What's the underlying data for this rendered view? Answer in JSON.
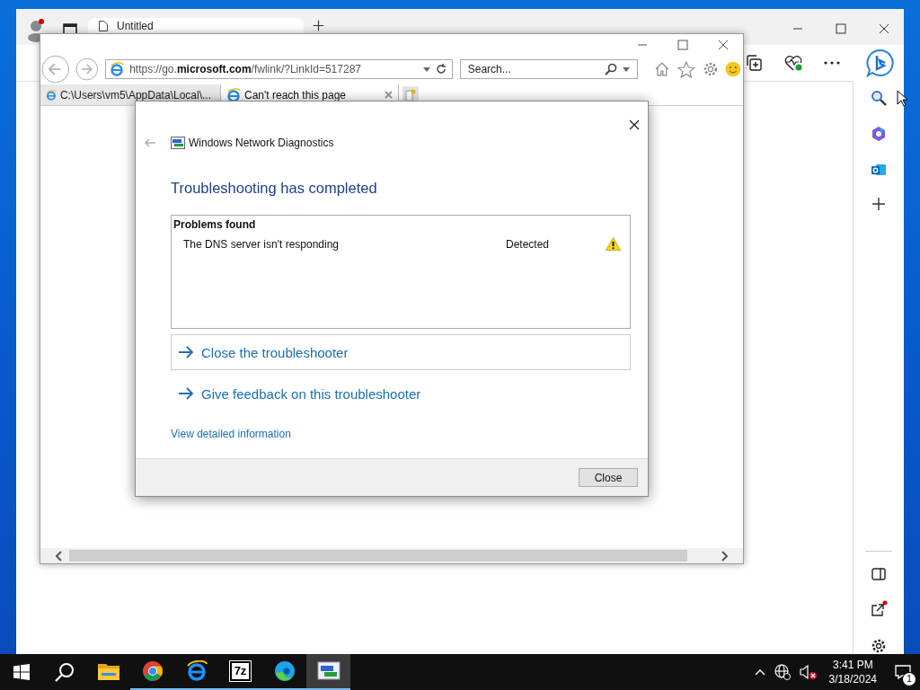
{
  "edge": {
    "tabs": [
      {
        "title": "Untitled",
        "selected": true
      }
    ],
    "profile_notification": true,
    "share_notification": true
  },
  "ie": {
    "address": "https://go.**microsoft.com**/fwlink/?LinkId=517287",
    "search": {
      "placeholder": "Search..."
    },
    "tabs": [
      {
        "title": "C:\\Users\\vm5\\AppData\\Local\\...",
        "selected": false
      },
      {
        "title": "Can't reach this page",
        "selected": true
      }
    ]
  },
  "dialog": {
    "title": "Windows Network Diagnostics",
    "heading": "Troubleshooting has completed",
    "problems": {
      "header": "Problems found",
      "rows": [
        {
          "text": "The DNS server isn't responding",
          "status": "Detected",
          "kind": "warning"
        }
      ]
    },
    "links": [
      {
        "label": "Close the troubleshooter",
        "kind": "boxed"
      },
      {
        "label": "Give feedback on this troubleshooter",
        "kind": "plain"
      }
    ],
    "details_link": "View detailed information",
    "button": "Close"
  },
  "taskbar": {
    "apps": [
      {
        "kind": "explorer",
        "running": false,
        "selected": false
      },
      {
        "kind": "chrome",
        "running": true,
        "selected": false
      },
      {
        "kind": "ie",
        "running": true,
        "selected": false
      },
      {
        "kind": "sevenzip",
        "label": "7z",
        "running": true,
        "selected": false
      },
      {
        "kind": "edge",
        "running": true,
        "selected": false
      },
      {
        "kind": "diagnostics",
        "running": true,
        "selected": true
      }
    ],
    "volume_muted": true,
    "time": "3:41 PM",
    "date": "3/18/2024",
    "notifications": "1"
  }
}
